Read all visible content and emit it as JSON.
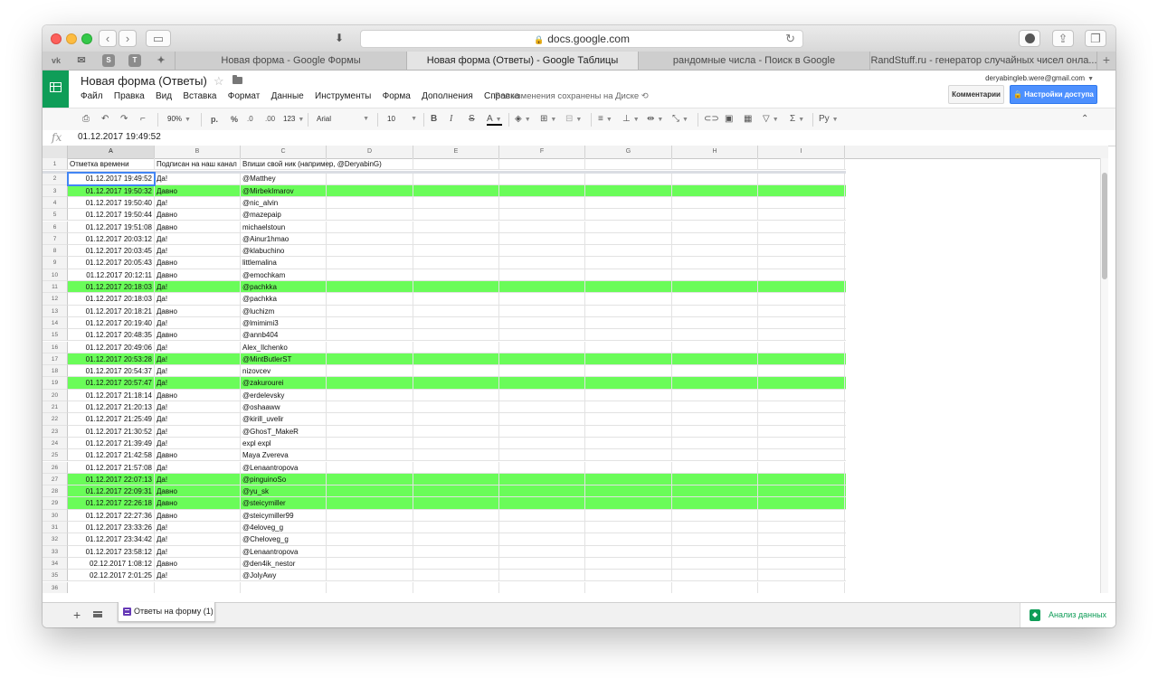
{
  "browser": {
    "address": "docs.google.com",
    "tabs": [
      {
        "label": "Новая форма - Google Формы",
        "active": false
      },
      {
        "label": "Новая форма (Ответы) - Google Таблицы",
        "active": true
      },
      {
        "label": "рандомные числа - Поиск в Google",
        "active": false
      },
      {
        "label": "RandStuff.ru - генератор случайных чисел онла...",
        "active": false
      }
    ],
    "favorites": [
      "vk-icon",
      "mail-icon",
      "s-icon",
      "t-icon",
      "twitter-icon"
    ]
  },
  "doc": {
    "title": "Новая форма (Ответы)",
    "saved_status": "Все изменения сохранены на Диске",
    "user_email": "deryabingleb.were@gmail.com",
    "comments_label": "Комментарии",
    "share_label": "Настройки доступа"
  },
  "menu": [
    "Файл",
    "Правка",
    "Вид",
    "Вставка",
    "Формат",
    "Данные",
    "Инструменты",
    "Форма",
    "Дополнения",
    "Справка"
  ],
  "toolbar": {
    "zoom": "90%",
    "currency": "р.",
    "percent": "%",
    "dec_decrease": ".0",
    "dec_increase": ".00",
    "number_format": "123",
    "font": "Arial",
    "font_size": "10",
    "bold": "B",
    "italic": "I",
    "strike": "S",
    "text_color": "A",
    "input_tools": "Ру"
  },
  "formula_bar": {
    "fx": "fx",
    "value": "01.12.2017 19:49:52"
  },
  "columns": [
    "A",
    "B",
    "C",
    "D",
    "E",
    "F",
    "G",
    "H",
    "I"
  ],
  "header_row": {
    "row": "1",
    "cells": [
      "Отметка времени",
      "Подписан на наш канал",
      "Впиши свой ник (например, @DeryabinG)"
    ]
  },
  "rows": [
    {
      "n": "2",
      "ts": "01.12.2017 19:49:52",
      "sub": "Да!",
      "nick": "@Matthey",
      "hl": false
    },
    {
      "n": "3",
      "ts": "01.12.2017 19:50:32",
      "sub": "Давно",
      "nick": "@MirbekImarov",
      "hl": true
    },
    {
      "n": "4",
      "ts": "01.12.2017 19:50:40",
      "sub": "Да!",
      "nick": "@nic_alvin",
      "hl": false
    },
    {
      "n": "5",
      "ts": "01.12.2017 19:50:44",
      "sub": "Давно",
      "nick": "@mazepaip",
      "hl": false
    },
    {
      "n": "6",
      "ts": "01.12.2017 19:51:08",
      "sub": "Давно",
      "nick": "michaelstoun",
      "hl": false
    },
    {
      "n": "7",
      "ts": "01.12.2017 20:03:12",
      "sub": "Да!",
      "nick": "@Ainur1hmao",
      "hl": false
    },
    {
      "n": "8",
      "ts": "01.12.2017 20:03:45",
      "sub": "Да!",
      "nick": "@klabuchino",
      "hl": false
    },
    {
      "n": "9",
      "ts": "01.12.2017 20:05:43",
      "sub": "Давно",
      "nick": "littlemalina",
      "hl": false
    },
    {
      "n": "10",
      "ts": "01.12.2017 20:12:11",
      "sub": "Давно",
      "nick": "@emochkam",
      "hl": false
    },
    {
      "n": "11",
      "ts": "01.12.2017 20:18:03",
      "sub": "Да!",
      "nick": "@pachkka",
      "hl": true
    },
    {
      "n": "12",
      "ts": "01.12.2017 20:18:03",
      "sub": "Да!",
      "nick": "@pachkka",
      "hl": false
    },
    {
      "n": "13",
      "ts": "01.12.2017 20:18:21",
      "sub": "Давно",
      "nick": "@luchizm",
      "hl": false
    },
    {
      "n": "14",
      "ts": "01.12.2017 20:19:40",
      "sub": "Да!",
      "nick": "@lmimimi3",
      "hl": false
    },
    {
      "n": "15",
      "ts": "01.12.2017 20:48:35",
      "sub": "Давно",
      "nick": "@annb404",
      "hl": false
    },
    {
      "n": "16",
      "ts": "01.12.2017 20:49:06",
      "sub": "Да!",
      "nick": "Alex_Ilchenko",
      "hl": false
    },
    {
      "n": "17",
      "ts": "01.12.2017 20:53:28",
      "sub": "Да!",
      "nick": "@MintButlerST",
      "hl": true
    },
    {
      "n": "18",
      "ts": "01.12.2017 20:54:37",
      "sub": "Да!",
      "nick": "nizovcev",
      "hl": false
    },
    {
      "n": "19",
      "ts": "01.12.2017 20:57:47",
      "sub": "Да!",
      "nick": "@zakurourei",
      "hl": true
    },
    {
      "n": "20",
      "ts": "01.12.2017 21:18:14",
      "sub": "Давно",
      "nick": "@erdelevsky",
      "hl": false
    },
    {
      "n": "21",
      "ts": "01.12.2017 21:20:13",
      "sub": "Да!",
      "nick": "@oshaaww",
      "hl": false
    },
    {
      "n": "22",
      "ts": "01.12.2017 21:25:49",
      "sub": "Да!",
      "nick": "@kirill_uvelir",
      "hl": false
    },
    {
      "n": "23",
      "ts": "01.12.2017 21:30:52",
      "sub": "Да!",
      "nick": "@GhosT_MakeR",
      "hl": false
    },
    {
      "n": "24",
      "ts": "01.12.2017 21:39:49",
      "sub": "Да!",
      "nick": "expl expl",
      "hl": false
    },
    {
      "n": "25",
      "ts": "01.12.2017 21:42:58",
      "sub": "Давно",
      "nick": "Maya Zvereva",
      "hl": false
    },
    {
      "n": "26",
      "ts": "01.12.2017 21:57:08",
      "sub": "Да!",
      "nick": "@Lenaantropova",
      "hl": false
    },
    {
      "n": "27",
      "ts": "01.12.2017 22:07:13",
      "sub": "Да!",
      "nick": "@pinguinoSo",
      "hl": true
    },
    {
      "n": "28",
      "ts": "01.12.2017 22:09:31",
      "sub": "Давно",
      "nick": "@yu_sk",
      "hl": true
    },
    {
      "n": "29",
      "ts": "01.12.2017 22:26:18",
      "sub": "Давно",
      "nick": "@steicymiller",
      "hl": true
    },
    {
      "n": "30",
      "ts": "01.12.2017 22:27:36",
      "sub": "Давно",
      "nick": "@steicymiller99",
      "hl": false
    },
    {
      "n": "31",
      "ts": "01.12.2017 23:33:26",
      "sub": "Да!",
      "nick": "@4eloveg_g",
      "hl": false
    },
    {
      "n": "32",
      "ts": "01.12.2017 23:34:42",
      "sub": "Да!",
      "nick": "@Cheloveg_g",
      "hl": false
    },
    {
      "n": "33",
      "ts": "01.12.2017 23:58:12",
      "sub": "Да!",
      "nick": "@Lenaantropova",
      "hl": false
    },
    {
      "n": "34",
      "ts": "02.12.2017 1:08:12",
      "sub": "Давно",
      "nick": "@den4ik_nestor",
      "hl": false
    },
    {
      "n": "35",
      "ts": "02.12.2017 2:01:25",
      "sub": "Да!",
      "nick": "@JolyAwy",
      "hl": false
    },
    {
      "n": "36",
      "ts": "",
      "sub": "",
      "nick": "",
      "hl": false
    }
  ],
  "sheet_tab": {
    "label": "Ответы на форму (1)"
  },
  "explore": {
    "label": "Анализ данных"
  },
  "colors": {
    "highlight": "#6afc59",
    "sheets_green": "#0f9d58",
    "share_blue": "#4d90fe",
    "selection": "#4285f4"
  }
}
